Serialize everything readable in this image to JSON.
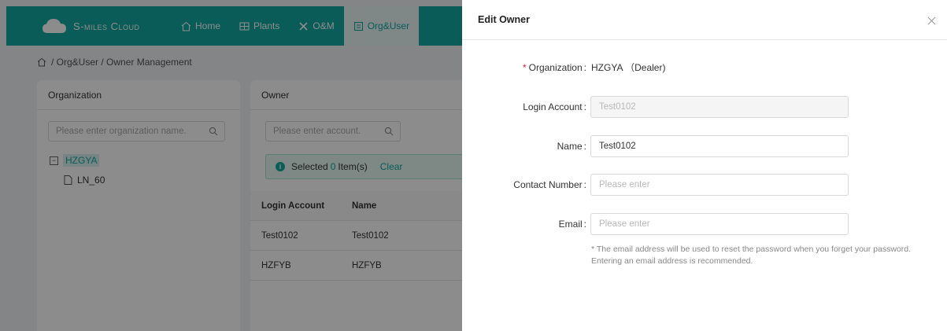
{
  "app": {
    "brand": "S-miles Cloud",
    "nav": [
      {
        "label": "Home",
        "icon": "home-icon"
      },
      {
        "label": "Plants",
        "icon": "plants-icon"
      },
      {
        "label": "O&M",
        "icon": "tools-icon"
      },
      {
        "label": "Org&User",
        "icon": "org-user-icon",
        "active": true
      }
    ],
    "breadcrumb": "/ Org&User / Owner Management",
    "organization_panel": {
      "title": "Organization",
      "search_placeholder": "Please enter organization name.",
      "tree": [
        {
          "label": "HZGYA",
          "expanded": true,
          "selected": true,
          "toggle": "−"
        },
        {
          "label": "LN_60"
        }
      ]
    },
    "owner_panel": {
      "title": "Owner",
      "search_placeholder": "Please enter account.",
      "selected_prefix": "Selected",
      "selected_count": "0",
      "selected_suffix": "Item(s)",
      "clear_label": "Clear",
      "columns": [
        "Login Account",
        "Name"
      ],
      "rows": [
        [
          "Test0102",
          "Test0102"
        ],
        [
          "HZFYB",
          "HZFYB"
        ]
      ]
    }
  },
  "drawer": {
    "title": "Edit Owner",
    "fields": {
      "organization": {
        "label": "Organization",
        "required": "*",
        "value": "HZGYA （Dealer)"
      },
      "login_account": {
        "label": "Login Account",
        "value": "Test0102"
      },
      "name": {
        "label": "Name",
        "value": "Test0102"
      },
      "contact_number": {
        "label": "Contact Number",
        "placeholder": "Please enter"
      },
      "email": {
        "label": "Email",
        "placeholder": "Please enter"
      }
    },
    "colon": ":",
    "email_hint": "* The email address will be used to reset the password when you forget your password. Entering an email address is recommended."
  },
  "colors": {
    "accent": "#13a8a2",
    "required": "#f5222d"
  }
}
